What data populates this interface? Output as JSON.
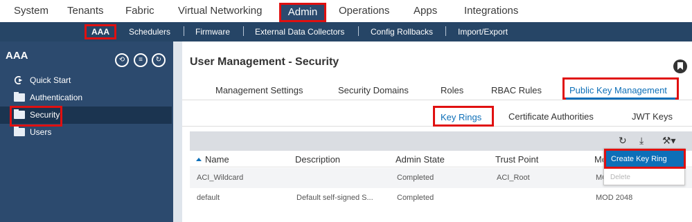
{
  "top_nav": {
    "tabs": [
      "System",
      "Tenants",
      "Fabric",
      "Virtual Networking",
      "Admin",
      "Operations",
      "Apps",
      "Integrations"
    ],
    "active": "Admin"
  },
  "sub_nav": {
    "items": [
      "AAA",
      "Schedulers",
      "Firmware",
      "External Data Collectors",
      "Config Rollbacks",
      "Import/Export"
    ],
    "active": "AAA"
  },
  "sidebar": {
    "title": "AAA",
    "controls": [
      "quick-start-icon",
      "list-icon",
      "refresh-icon"
    ],
    "items": [
      {
        "label": "Quick Start",
        "icon": "quick-start-icon"
      },
      {
        "label": "Authentication",
        "icon": "folder-icon"
      },
      {
        "label": "Security",
        "icon": "folder-icon"
      },
      {
        "label": "Users",
        "icon": "folder-icon"
      }
    ],
    "active": "Security"
  },
  "main": {
    "title": "User Management - Security",
    "tabs": [
      "Management Settings",
      "Security Domains",
      "Roles",
      "RBAC Rules",
      "Public Key Management"
    ],
    "active_tab": "Public Key Management",
    "subtabs": [
      "Key Rings",
      "Certificate Authorities",
      "JWT Keys"
    ],
    "active_subtab": "Key Rings",
    "toolbar_icons": [
      "refresh-icon",
      "download-icon",
      "tools-icon"
    ],
    "table": {
      "columns": [
        "Name",
        "Description",
        "Admin State",
        "Trust Point",
        "Mo"
      ],
      "rows": [
        [
          "ACI_Wildcard",
          "",
          "Completed",
          "ACI_Root",
          "MO"
        ],
        [
          "default",
          "Default self-signed S...",
          "Completed",
          "",
          "MOD 2048"
        ]
      ]
    },
    "actions_menu": {
      "items": [
        "Create Key Ring",
        "Delete"
      ],
      "selected": "Create Key Ring"
    }
  },
  "colors": {
    "header_bg": "#264566",
    "sidebar_bg": "#2c4a6e",
    "accent": "#0d6fb8",
    "highlight_border": "#e01010"
  }
}
